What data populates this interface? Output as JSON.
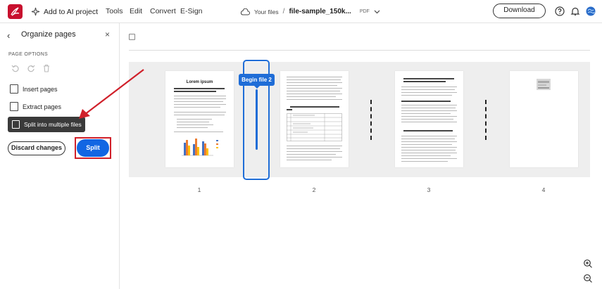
{
  "toolbar": {
    "ai_label": "Add to AI project",
    "menu": [
      "Tools",
      "Edit",
      "Convert",
      "E-Sign"
    ],
    "your_files": "Your files",
    "separator": "/",
    "file_name": "file-sample_150k...",
    "file_type": "PDF",
    "download": "Download",
    "brand_color": "#c8102e"
  },
  "panel": {
    "title": "Organize pages",
    "section": "PAGE OPTIONS",
    "insert": "Insert pages",
    "extract": "Extract pages",
    "split_multiple": "Split into multiple files",
    "discard": "Discard changes",
    "split": "Split",
    "accent": "#1266e3"
  },
  "main": {
    "begin_tip": "Begin file 2",
    "page_numbers": [
      "1",
      "2",
      "3",
      "4"
    ],
    "page1_title": "Lorem ipsum"
  }
}
